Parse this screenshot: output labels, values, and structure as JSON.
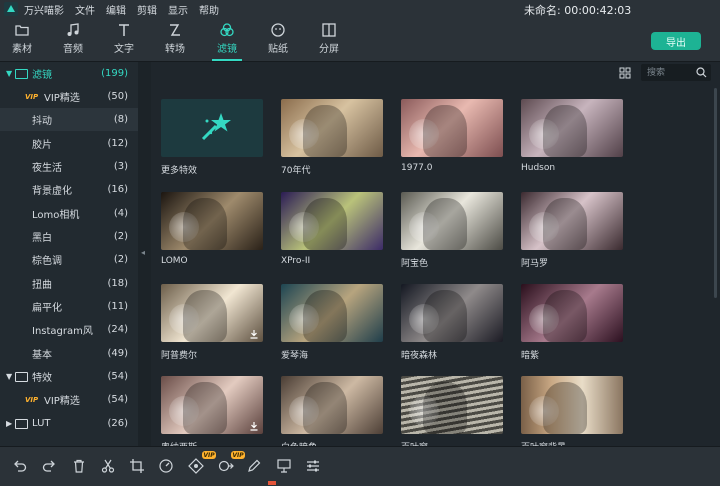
{
  "menu": {
    "app_name": "万兴喵影",
    "items": [
      "文件",
      "编辑",
      "剪辑",
      "显示",
      "帮助"
    ],
    "project_title": "未命名: 00:00:42:03"
  },
  "toolbar": {
    "tools": [
      {
        "label": "素材",
        "icon": "folder-icon"
      },
      {
        "label": "音频",
        "icon": "music-note-icon"
      },
      {
        "label": "文字",
        "icon": "text-icon"
      },
      {
        "label": "转场",
        "icon": "transition-icon"
      },
      {
        "label": "滤镜",
        "icon": "filter-icon",
        "active": true
      },
      {
        "label": "贴纸",
        "icon": "sticker-icon"
      },
      {
        "label": "分屏",
        "icon": "split-screen-icon"
      }
    ],
    "export_label": "导出",
    "accent": "#34d9c3",
    "export_color": "#1db394"
  },
  "sidebar": {
    "items": [
      {
        "label": "滤镜",
        "count": "(199)",
        "type": "root",
        "expanded": true
      },
      {
        "label": "VIP精选",
        "count": "(50)",
        "type": "vip"
      },
      {
        "label": "抖动",
        "count": "(8)",
        "type": "child",
        "selected": true
      },
      {
        "label": "胶片",
        "count": "(12)",
        "type": "child"
      },
      {
        "label": "夜生活",
        "count": "(3)",
        "type": "child"
      },
      {
        "label": "背景虚化",
        "count": "(16)",
        "type": "child"
      },
      {
        "label": "Lomo相机",
        "count": "(4)",
        "type": "child"
      },
      {
        "label": "黑白",
        "count": "(2)",
        "type": "child"
      },
      {
        "label": "棕色调",
        "count": "(2)",
        "type": "child"
      },
      {
        "label": "扭曲",
        "count": "(18)",
        "type": "child"
      },
      {
        "label": "扁平化",
        "count": "(11)",
        "type": "child"
      },
      {
        "label": "Instagram风",
        "count": "(24)",
        "type": "child"
      },
      {
        "label": "基本",
        "count": "(49)",
        "type": "child"
      },
      {
        "label": "特效",
        "count": "(54)",
        "type": "root",
        "expanded": true
      },
      {
        "label": "VIP精选",
        "count": "(54)",
        "type": "vip"
      },
      {
        "label": "LUT",
        "count": "(26)",
        "type": "root",
        "expanded": false
      }
    ],
    "vip_badge": "VIP"
  },
  "search": {
    "placeholder": "搜索"
  },
  "filters": [
    {
      "label": "更多特效",
      "style": "more"
    },
    {
      "label": "70年代",
      "style": "seventies"
    },
    {
      "label": "1977.0",
      "style": "pink"
    },
    {
      "label": "Hudson",
      "style": "hudson"
    },
    {
      "label": "LOMO",
      "style": "lomo"
    },
    {
      "label": "XPro-II",
      "style": "xpro"
    },
    {
      "label": "阿宝色",
      "style": "abao"
    },
    {
      "label": "阿马罗",
      "style": "amaro"
    },
    {
      "label": "阿普费尔",
      "style": "apfel",
      "download": true
    },
    {
      "label": "爱琴海",
      "style": "aegean"
    },
    {
      "label": "暗夜森林",
      "style": "darkforest"
    },
    {
      "label": "暗紫",
      "style": "darkpurple"
    },
    {
      "label": "奥纳西斯",
      "style": "onassis",
      "download": true
    },
    {
      "label": "白色暗角",
      "style": "whitevignette"
    },
    {
      "label": "百叶窗",
      "style": "blinds"
    },
    {
      "label": "百叶窗背景",
      "style": "blindsbg"
    }
  ],
  "bottom_toolbar": {
    "icons": [
      "undo-icon",
      "redo-icon",
      "delete-icon",
      "cut-icon",
      "crop-icon",
      "speed-icon",
      "color-match-icon",
      "motion-track-icon",
      "pen-icon",
      "marker-icon",
      "audio-mixer-icon"
    ],
    "vip_badge": "VIP"
  }
}
